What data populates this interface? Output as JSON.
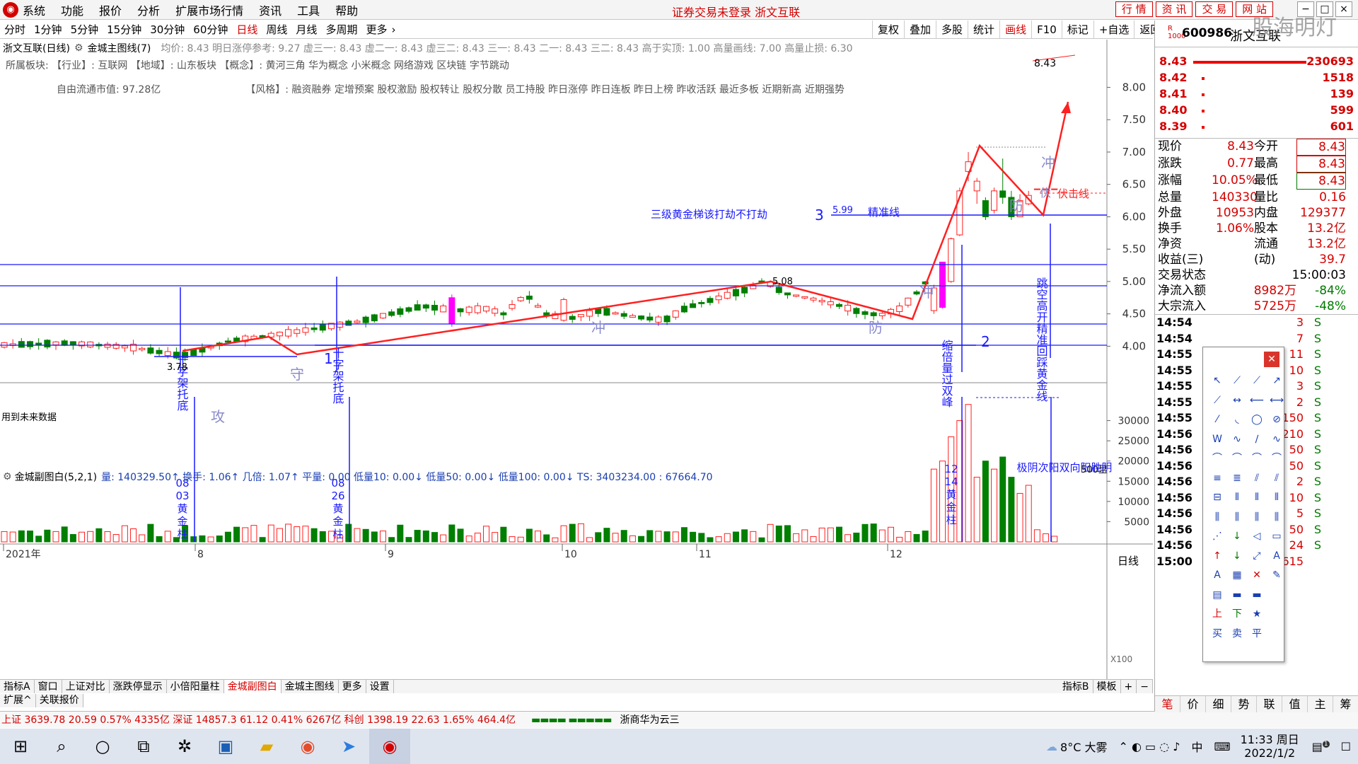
{
  "menubar": {
    "items": [
      "系统",
      "功能",
      "报价",
      "分析",
      "扩展市场行情",
      "资讯",
      "工具",
      "帮助"
    ],
    "center": "证券交易未登录 浙文互联",
    "buttons": [
      "行 情",
      "资 讯",
      "交 易",
      "网 站"
    ],
    "win": [
      "−",
      "□",
      "×"
    ]
  },
  "periods": [
    "分时",
    "1分钟",
    "5分钟",
    "15分钟",
    "30分钟",
    "60分钟",
    "日线",
    "周线",
    "月线",
    "多周期",
    "更多"
  ],
  "active_period": "日线",
  "toolbar_right": [
    "复权",
    "叠加",
    "多股",
    "统计",
    "画线",
    "F10",
    "标记",
    "+自选",
    "返回"
  ],
  "stock_header": {
    "title": "浙文互联(日线)",
    "main_indicator": "金城主图线(7)",
    "info": "均价: 8.43 明日涨停参考: 9.27 虚三一: 8.43 虚二一: 8.43 虚三二: 8.43 三一: 8.43 二一: 8.43 三二: 8.43 高于实顶: 1.00 高量画线: 7.00 高量止损: 6.30"
  },
  "tags": {
    "row1": "所属板块:  【行业】: 互联网  【地域】: 山东板块  【概念】: 黄河三角 华为概念 小米概念 网络游戏 区块链 字节跳动",
    "free_cap": "自由流通市值: 97.28亿",
    "style": "【风格】: 融资融券 定增预案 股权激励 股权转让 股权分散 员工持股 昨日涨停 昨日连板 昨日上榜 昨收活跃 最近多板 近期新高 近期强势"
  },
  "price_axis": [
    "8.00",
    "7.50",
    "7.00",
    "6.50",
    "6.00",
    "5.50",
    "5.00",
    "4.50",
    "4.00"
  ],
  "vol_axis": [
    "30000",
    "25000",
    "20000",
    "15000",
    "10000",
    "5000"
  ],
  "date_axis": [
    "2021年",
    "8",
    "9",
    "10",
    "11",
    "12"
  ],
  "annotations": {
    "cross1": "十字架托底",
    "cross2": "十字架托底",
    "gong": "攻",
    "shou": "守",
    "chong1": "冲",
    "fang1": "防",
    "chong2": "冲",
    "fang2": "防",
    "chong3": "冲",
    "fu": "伏",
    "fujixian": "伏击线",
    "ladder": "三级黄金梯该打劫不打劫",
    "precise": "精准线",
    "precise_val": "5.99",
    "n3": "3",
    "n1": "1",
    "n2": "2",
    "suoliang": "缩倍量过双峰",
    "tiaokong": "跳空高开精准回踩黄金线",
    "low": "3.78",
    "high": "5.08",
    "last": "8.43",
    "future": "用到未来数据",
    "vol_col1": "08 03 黄 金 柱",
    "vol_col2": "08 26 黄 金 柱",
    "vol_col3": "12 14 黄 金 柱",
    "vol_col4": "极阴次阳双向阳胜阴",
    "vol_500": "500里",
    "x100": "X100"
  },
  "sub_indicator": {
    "name": "金城副图白(5,2,1)",
    "info": "量: 140329.50↑ 换手: 1.06↑ 几倍: 1.07↑ 平量: 0.00 低量10: 0.00↓ 低量50: 0.00↓ 低量100: 0.00↓ TS: 3403234.00 : 67664.70"
  },
  "bottom_tabs": [
    "指标A",
    "窗口",
    "上证对比",
    "涨跌停显示",
    "小倍阳量柱",
    "金城副图白",
    "金城主图线",
    "更多",
    "设置"
  ],
  "bottom_tabs_right": [
    "指标B",
    "模板",
    "+",
    "−"
  ],
  "bottom_tabs2": [
    "扩展^",
    "关联报价"
  ],
  "indexbar": "上证 3639.78  20.59  0.57%  4335亿   深证 14857.3  61.12  0.41%  6267亿   科创 1398.19  22.63  1.65%  464.4亿",
  "indexbar_msg": "浙商华为云三",
  "right": {
    "code": "600986",
    "name": "浙文互联",
    "book": [
      {
        "p": "8.43",
        "v": "230693"
      },
      {
        "p": "8.42",
        "v": "1518"
      },
      {
        "p": "8.41",
        "v": "139"
      },
      {
        "p": "8.40",
        "v": "599"
      },
      {
        "p": "8.39",
        "v": "601"
      }
    ],
    "quote": [
      [
        "现价",
        "8.43",
        "今开",
        "8.43"
      ],
      [
        "涨跌",
        "0.77",
        "最高",
        "8.43"
      ],
      [
        "涨幅",
        "10.05%",
        "最低",
        "8.43"
      ],
      [
        "总量",
        "140330",
        "量比",
        "0.16"
      ],
      [
        "外盘",
        "10953",
        "内盘",
        "129377"
      ],
      [
        "换手",
        "1.06%",
        "股本",
        "13.2亿"
      ],
      [
        "净资",
        "",
        "流通",
        "13.2亿"
      ],
      [
        "收益(三)",
        "",
        "(动)",
        "39.7"
      ]
    ],
    "status": "交易状态",
    "time": "15:00:03",
    "net": "净流入额",
    "net_v": "8982万",
    "net_p": "-84%",
    "big": "大宗流入",
    "big_v": "5725万",
    "big_p": "-48%",
    "trades": [
      [
        "14:54",
        "",
        "3",
        "S"
      ],
      [
        "14:54",
        "",
        "7",
        "S"
      ],
      [
        "14:55",
        "",
        "11",
        "S"
      ],
      [
        "14:55",
        "",
        "10",
        "S"
      ],
      [
        "14:55",
        "",
        "3",
        "S"
      ],
      [
        "14:55",
        "",
        "2",
        "S"
      ],
      [
        "14:55",
        "",
        "150",
        "S"
      ],
      [
        "14:56",
        "",
        "210",
        "S"
      ],
      [
        "14:56",
        "",
        "50",
        "S"
      ],
      [
        "14:56",
        "",
        "50",
        "S"
      ],
      [
        "14:56",
        "",
        "2",
        "S"
      ],
      [
        "14:56",
        "",
        "10",
        "S"
      ],
      [
        "14:56",
        "",
        "5",
        "S"
      ],
      [
        "14:56",
        "",
        "50",
        "S"
      ],
      [
        "14:56",
        "",
        "24",
        "S"
      ],
      [
        "15:00",
        "8.43",
        "10615",
        ""
      ]
    ],
    "tabs": [
      "笔",
      "价",
      "细",
      "势",
      "联",
      "值",
      "主",
      "筹"
    ]
  },
  "taskbar": {
    "weather": "8°C 大雾",
    "ime": "中",
    "time": "11:33 周日",
    "date": "2022/1/2",
    "notif": "1"
  },
  "colors": {
    "up": "#ff2020",
    "down": "#007f00",
    "line": "#0000ff",
    "accent": "#d40000"
  }
}
